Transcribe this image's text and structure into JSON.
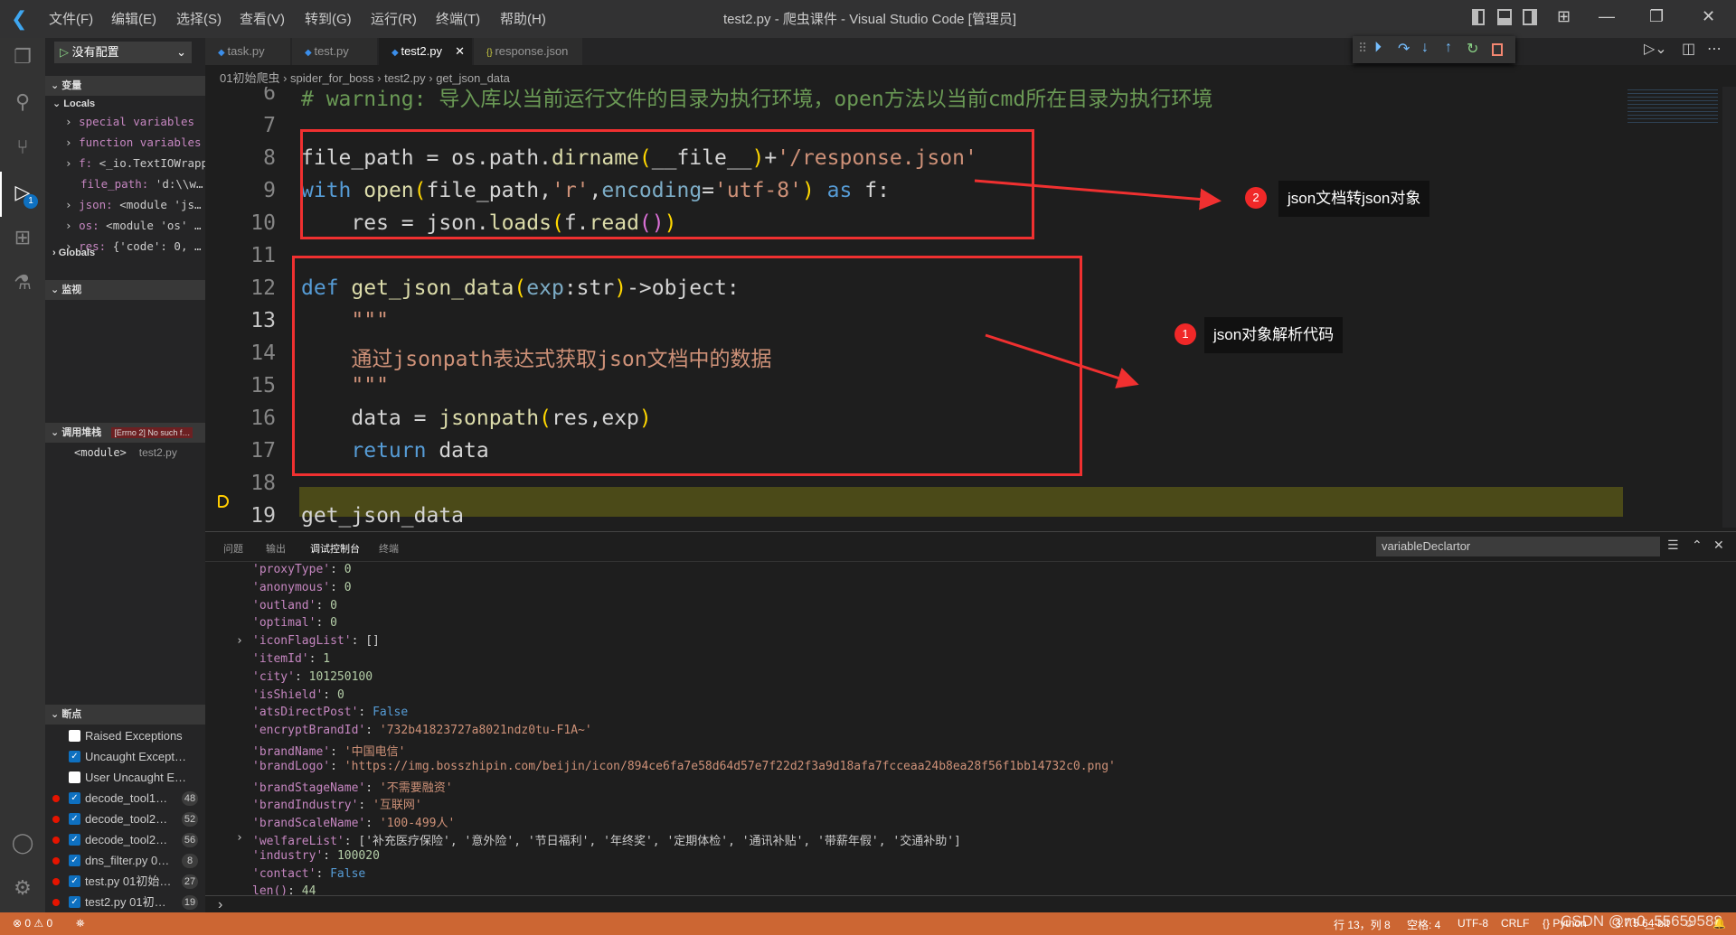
{
  "titlebar": {
    "menus": [
      "文件(F)",
      "编辑(E)",
      "选择(S)",
      "查看(V)",
      "转到(G)",
      "运行(R)",
      "终端(T)",
      "帮助(H)"
    ],
    "title": "test2.py - 爬虫课件 - Visual Studio Code [管理员]"
  },
  "sidebar": {
    "run_config": "没有配置",
    "variables_header": "变量",
    "locals": "Locals",
    "vars": [
      {
        "name": "special variables",
        "value": "",
        "expandable": true
      },
      {
        "name": "function variables",
        "value": "",
        "expandable": true
      },
      {
        "name": "f:",
        "value": " <_io.TextIOWrapper…",
        "expandable": true
      },
      {
        "name": "file_path:",
        "value": " 'd:\\\\w…",
        "expandable": false
      },
      {
        "name": "json:",
        "value": " <module 'js…",
        "expandable": true
      },
      {
        "name": "os:",
        "value": " <module 'os' …",
        "expandable": true
      },
      {
        "name": "res:",
        "value": " {'code': 0, …",
        "expandable": true
      }
    ],
    "globals": "Globals",
    "watch_header": "监视",
    "callstack_header": "调用堆栈",
    "callstack_error": "[Errno 2] No such f…",
    "callstack_frame": "<module>",
    "callstack_file": "test2.py",
    "breakpoints_header": "断点",
    "breakpoints": [
      {
        "label": "Raised Exceptions",
        "checked": false,
        "dot": false,
        "count": ""
      },
      {
        "label": "Uncaught Except…",
        "checked": true,
        "dot": false,
        "count": ""
      },
      {
        "label": "User Uncaught E…",
        "checked": false,
        "dot": false,
        "count": ""
      },
      {
        "label": "decode_tool1…",
        "checked": true,
        "dot": true,
        "count": "48"
      },
      {
        "label": "decode_tool2…",
        "checked": true,
        "dot": true,
        "count": "52"
      },
      {
        "label": "decode_tool2…",
        "checked": true,
        "dot": true,
        "count": "56"
      },
      {
        "label": "dns_filter.py  0…",
        "checked": true,
        "dot": true,
        "count": "8"
      },
      {
        "label": "test.py  01初始…",
        "checked": true,
        "dot": true,
        "count": "27"
      },
      {
        "label": "test2.py  01初…",
        "checked": true,
        "dot": true,
        "count": "19"
      }
    ],
    "debug_badge": "1"
  },
  "tabs": [
    {
      "label": "task.py",
      "active": false
    },
    {
      "label": "test.py",
      "active": false
    },
    {
      "label": "test2.py",
      "active": true
    },
    {
      "label": "response.json",
      "active": false
    }
  ],
  "breadcrumb": [
    "01初始爬虫",
    "spider_for_boss",
    "test2.py",
    "get_json_data"
  ],
  "editor": {
    "lines": [
      {
        "n": "6",
        "tokens": [
          [
            "cm",
            "# warning: 导入库以当前运行文件的目录为执行环境，open方法以当前cmd所在目录为执行环境"
          ]
        ]
      },
      {
        "n": "7",
        "tokens": []
      },
      {
        "n": "8",
        "tokens": [
          [
            "id",
            "file_path = os.path."
          ],
          [
            "fn",
            "dirname"
          ],
          [
            "p1",
            "("
          ],
          [
            "id",
            "__file__"
          ],
          [
            "p1",
            ")"
          ],
          [
            "id",
            "+"
          ],
          [
            "str",
            "'/response.json'"
          ]
        ]
      },
      {
        "n": "9",
        "tokens": [
          [
            "ctl",
            "with "
          ],
          [
            "fn",
            "open"
          ],
          [
            "p1",
            "("
          ],
          [
            "id",
            "file_path,"
          ],
          [
            "str",
            "'r'"
          ],
          [
            "id",
            ","
          ],
          [
            "param",
            "encoding"
          ],
          [
            "id",
            "="
          ],
          [
            "str",
            "'utf-8'"
          ],
          [
            "p1",
            ")"
          ],
          [
            "kw",
            " as "
          ],
          [
            "id",
            "f:"
          ]
        ]
      },
      {
        "n": "10",
        "tokens": [
          [
            "id",
            "    res = json."
          ],
          [
            "fn",
            "loads"
          ],
          [
            "p1",
            "("
          ],
          [
            "id",
            "f."
          ],
          [
            "fn",
            "read"
          ],
          [
            "p2",
            "()"
          ],
          [
            "p1",
            ")"
          ]
        ]
      },
      {
        "n": "11",
        "tokens": []
      },
      {
        "n": "12",
        "tokens": [
          [
            "kw",
            "def "
          ],
          [
            "fn",
            "get_json_data"
          ],
          [
            "p1",
            "("
          ],
          [
            "param",
            "exp"
          ],
          [
            "id",
            ":str"
          ],
          [
            "p1",
            ")"
          ],
          [
            "id",
            "->object:"
          ]
        ]
      },
      {
        "n": "13",
        "tokens": [
          [
            "str",
            "    \"\"\""
          ]
        ]
      },
      {
        "n": "14",
        "tokens": [
          [
            "str",
            "    通过jsonpath表达式获取json文档中的数据"
          ]
        ]
      },
      {
        "n": "15",
        "tokens": [
          [
            "str",
            "    \"\"\""
          ]
        ]
      },
      {
        "n": "16",
        "tokens": [
          [
            "id",
            "    data = "
          ],
          [
            "fn",
            "jsonpath"
          ],
          [
            "p1",
            "("
          ],
          [
            "id",
            "res,exp"
          ],
          [
            "p1",
            ")"
          ]
        ]
      },
      {
        "n": "17",
        "tokens": [
          [
            "ctl",
            "    return "
          ],
          [
            "id",
            "data"
          ]
        ]
      },
      {
        "n": "18",
        "tokens": []
      },
      {
        "n": "19",
        "tokens": [
          [
            "id",
            "get_json_data"
          ]
        ]
      }
    ],
    "current_line": "19"
  },
  "annotations": [
    {
      "num": "2",
      "text": "json文档转json对象"
    },
    {
      "num": "1",
      "text": "json对象解析代码"
    }
  ],
  "panel": {
    "tabs": [
      {
        "label": "问题",
        "active": false
      },
      {
        "label": "输出",
        "active": false
      },
      {
        "label": "调试控制台",
        "active": true
      },
      {
        "label": "终端",
        "active": false
      }
    ],
    "filter_value": "variableDeclartor",
    "lines": [
      {
        "k": "'proxyType'",
        "v": "0",
        "t": "n"
      },
      {
        "k": "'anonymous'",
        "v": "0",
        "t": "n"
      },
      {
        "k": "'outland'",
        "v": "0",
        "t": "n"
      },
      {
        "k": "'optimal'",
        "v": "0",
        "t": "n"
      },
      {
        "k": "'iconFlagList'",
        "v": "[]",
        "t": "o",
        "exp": true
      },
      {
        "k": "'itemId'",
        "v": "1",
        "t": "n"
      },
      {
        "k": "'city'",
        "v": "101250100",
        "t": "n"
      },
      {
        "k": "'isShield'",
        "v": "0",
        "t": "n"
      },
      {
        "k": "'atsDirectPost'",
        "v": "False",
        "t": "b"
      },
      {
        "k": "'encryptBrandId'",
        "v": "'732b41823727a8021ndz0tu-F1A~'",
        "t": "s"
      },
      {
        "k": "'brandName'",
        "v": "'中国电信'",
        "t": "s"
      },
      {
        "k": "'brandLogo'",
        "v": "'https://img.bosszhipin.com/beijin/icon/894ce6fa7e58d64d57e7f22d2f3a9d18afa7fcceaa24b8ea28f56f1bb14732c0.png'",
        "t": "s"
      },
      {
        "k": "'brandStageName'",
        "v": "'不需要融资'",
        "t": "s"
      },
      {
        "k": "'brandIndustry'",
        "v": "'互联网'",
        "t": "s"
      },
      {
        "k": "'brandScaleName'",
        "v": "'100-499人'",
        "t": "s"
      },
      {
        "k": "'welfareList'",
        "v": "['补充医疗保险', '意外险', '节日福利', '年终奖', '定期体检', '通讯补贴', '带薪年假', '交通补助']",
        "t": "o",
        "exp": true
      },
      {
        "k": "'industry'",
        "v": "100020",
        "t": "n"
      },
      {
        "k": "'contact'",
        "v": "False",
        "t": "b"
      },
      {
        "k": "len()",
        "v": "44",
        "t": "n"
      }
    ]
  },
  "status": {
    "errors": "0",
    "warnings": "0",
    "position": "行 13，列 8",
    "spaces": "空格: 4",
    "encoding": "UTF-8",
    "eol": "CRLF",
    "language": "Python",
    "interpreter": "3.7.5 64-bit",
    "watermark": "CSDN @m0_55659588"
  }
}
